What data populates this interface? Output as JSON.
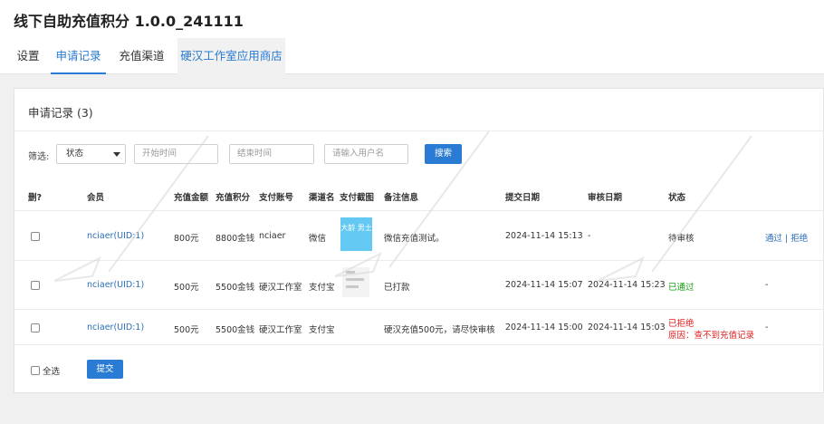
{
  "app": {
    "title": "线下自助充值积分 1.0.0_241111"
  },
  "tabs": [
    {
      "label": "设置"
    },
    {
      "label": "申请记录"
    },
    {
      "label": "充值渠道"
    },
    {
      "label": "硬汉工作室应用商店"
    }
  ],
  "card": {
    "title": "申请记录 (3)"
  },
  "filter": {
    "label": "筛选:",
    "status_value": "状态",
    "start_placeholder": "开始时间",
    "end_placeholder": "结束时间",
    "user_placeholder": "请输入用户名",
    "search_label": "搜索"
  },
  "table": {
    "headers": [
      "删?",
      "会员",
      "充值金额",
      "充值积分",
      "支付账号",
      "渠道名",
      "支付截图",
      "备注信息",
      "提交日期",
      "审核日期",
      "状态"
    ],
    "rows": [
      {
        "member": "nciaer(UID:1)",
        "amount": "800元",
        "points": "8800金钱",
        "account": "nciaer",
        "channel": "微信",
        "screenshot_text": "大龄 男士",
        "remark": "微信充值测试。",
        "submit_date": "2024-11-14 15:13",
        "review_date": "-",
        "status": "待审核",
        "approve_label": "通过",
        "separator": "|",
        "reject_label": "拒绝"
      },
      {
        "member": "nciaer(UID:1)",
        "amount": "500元",
        "points": "5500金钱",
        "account": "硬汉工作室",
        "channel": "支付宝",
        "remark": "已打款",
        "submit_date": "2024-11-14 15:07",
        "review_date": "2024-11-14 15:23",
        "status": "已通过",
        "action": "-"
      },
      {
        "member": "nciaer(UID:1)",
        "amount": "500元",
        "points": "5500金钱",
        "account": "硬汉工作室",
        "channel": "支付宝",
        "remark": "硬汉充值500元，请尽快审核",
        "submit_date": "2024-11-14 15:00",
        "review_date": "2024-11-14 15:03",
        "status": "已拒绝",
        "reason": "原因：查不到充值记录",
        "action": "-"
      }
    ]
  },
  "footer": {
    "select_all_label": "全选",
    "submit_label": "提交"
  },
  "colors": {
    "accent": "#2a7bd3",
    "approved": "#17a017",
    "rejected": "#e02020",
    "link": "#2a6fb8"
  }
}
